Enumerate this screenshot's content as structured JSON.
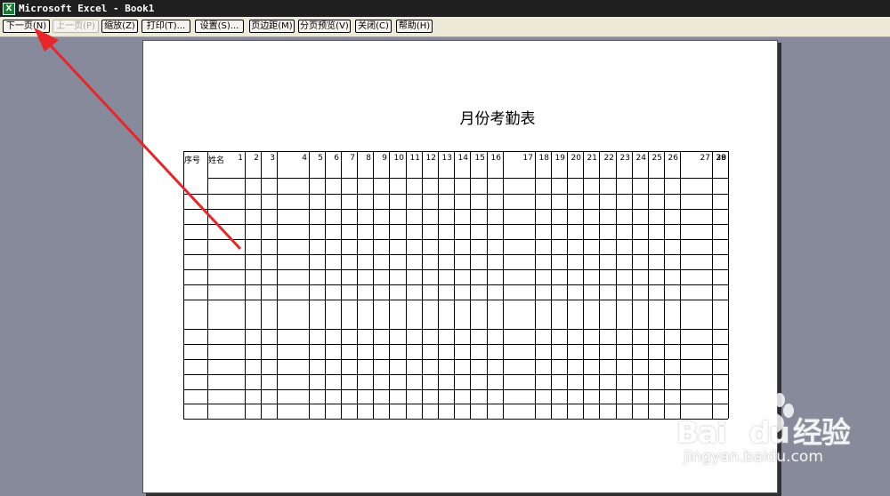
{
  "window": {
    "title": "Microsoft Excel - Book1",
    "icon": "excel-app-icon"
  },
  "toolbar": {
    "next": "下一页(N)",
    "prev": "上一页(P)",
    "zoom": "缩放(Z)",
    "print": "打印(T)...",
    "setup": "设置(S)...",
    "margins": "页边距(M)",
    "pagebreak": "分页预览(V)",
    "close": "关闭(C)",
    "help": "帮助(H)"
  },
  "sheet": {
    "title": "月份考勤表",
    "col_seq": "序号",
    "col_name": "姓名",
    "days": [
      "1",
      "2",
      "3",
      "4",
      "5",
      "6",
      "7",
      "8",
      "9",
      "10",
      "11",
      "12",
      "13",
      "14",
      "15",
      "16",
      "17",
      "18",
      "19",
      "20",
      "21",
      "22",
      "23",
      "24",
      "25",
      "26",
      "27",
      "28",
      "29",
      "30"
    ]
  },
  "annotation": {
    "arrow_color": "#e8262a"
  },
  "watermark": {
    "brand_a": "Bai",
    "brand_b": "du",
    "brand_c": "经验",
    "url": "jingyan.baidu.com"
  }
}
